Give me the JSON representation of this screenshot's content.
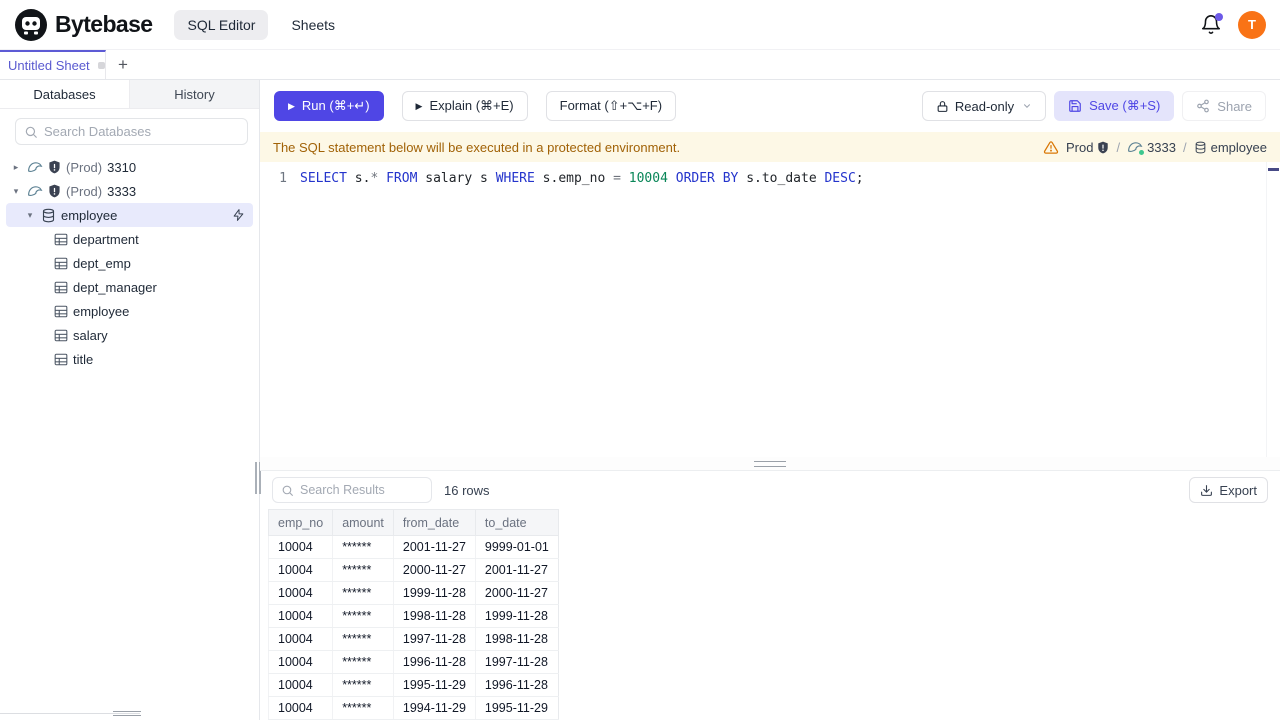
{
  "header": {
    "brand": "Bytebase",
    "nav_sql_editor": "SQL Editor",
    "nav_sheets": "Sheets",
    "avatar_initial": "T"
  },
  "tabbar": {
    "active_tab": "Untitled Sheet",
    "add_label": "+"
  },
  "sidebar": {
    "tab_databases": "Databases",
    "tab_history": "History",
    "search_placeholder": "Search Databases",
    "instances": [
      {
        "prefix": "(Prod)",
        "id": "3310"
      },
      {
        "prefix": "(Prod)",
        "id": "3333"
      }
    ],
    "database": "employee",
    "tables": [
      "department",
      "dept_emp",
      "dept_manager",
      "employee",
      "salary",
      "title"
    ]
  },
  "toolbar": {
    "run": "Run (⌘+↵)",
    "explain": "Explain (⌘+E)",
    "format": "Format (⇧+⌥+F)",
    "readonly": "Read-only",
    "save": "Save (⌘+S)",
    "share": "Share"
  },
  "banner": {
    "message": "The SQL statement below will be executed in a protected environment.",
    "environment": "Prod",
    "instance": "3333",
    "database": "employee",
    "separator": "/"
  },
  "editor": {
    "line_number": "1",
    "tokens": [
      {
        "t": "SELECT",
        "c": "kw"
      },
      {
        "t": " s.",
        "c": "pl"
      },
      {
        "t": "*",
        "c": "op"
      },
      {
        "t": " ",
        "c": "pl"
      },
      {
        "t": "FROM",
        "c": "kw"
      },
      {
        "t": " salary s ",
        "c": "pl"
      },
      {
        "t": "WHERE",
        "c": "kw"
      },
      {
        "t": " s.emp_no ",
        "c": "pl"
      },
      {
        "t": "=",
        "c": "op"
      },
      {
        "t": " ",
        "c": "pl"
      },
      {
        "t": "10004",
        "c": "num"
      },
      {
        "t": " ",
        "c": "pl"
      },
      {
        "t": "ORDER BY",
        "c": "kw"
      },
      {
        "t": " s.to_date ",
        "c": "pl"
      },
      {
        "t": "DESC",
        "c": "kw"
      },
      {
        "t": ";",
        "c": "pl"
      }
    ]
  },
  "results": {
    "search_placeholder": "Search Results",
    "row_count": "16 rows",
    "export_label": "Export",
    "columns": [
      "emp_no",
      "amount",
      "from_date",
      "to_date"
    ],
    "rows": [
      [
        "10004",
        "******",
        "2001-11-27",
        "9999-01-01"
      ],
      [
        "10004",
        "******",
        "2000-11-27",
        "2001-11-27"
      ],
      [
        "10004",
        "******",
        "1999-11-28",
        "2000-11-27"
      ],
      [
        "10004",
        "******",
        "1998-11-28",
        "1999-11-28"
      ],
      [
        "10004",
        "******",
        "1997-11-28",
        "1998-11-28"
      ],
      [
        "10004",
        "******",
        "1996-11-28",
        "1997-11-28"
      ],
      [
        "10004",
        "******",
        "1995-11-29",
        "1996-11-28"
      ],
      [
        "10004",
        "******",
        "1994-11-29",
        "1995-11-29"
      ]
    ]
  },
  "icons": {
    "caret_collapsed": "▸",
    "caret_expanded": "▾",
    "play": "▶"
  },
  "colors": {
    "accent": "#4f46e5",
    "avatar_bg": "#f97316",
    "warning_bg": "#fdf8e6",
    "warning_text": "#a16207",
    "sql_keyword": "#2434cc",
    "sql_number": "#098658",
    "selected_row_bg": "#e8eafc",
    "status_green": "#3ec78f"
  }
}
